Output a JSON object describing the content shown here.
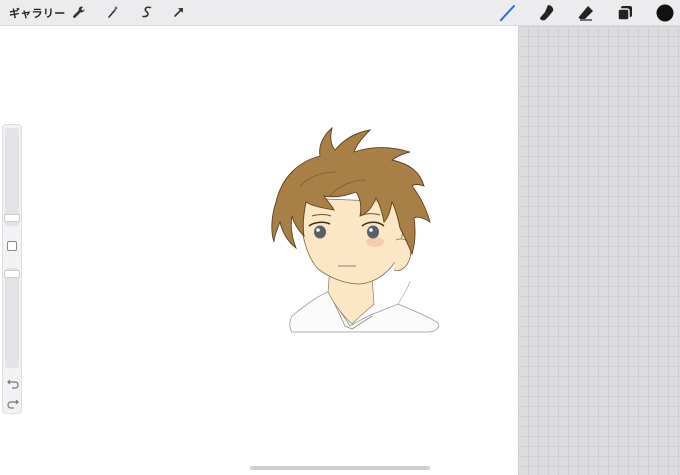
{
  "toolbar": {
    "gallery_label": "ギャラリー",
    "left_tools": [
      "wrench-icon",
      "magic-wand-icon",
      "selection-icon",
      "transform-arrow-icon"
    ],
    "right_tools": [
      "brush-icon",
      "smudge-icon",
      "eraser-icon",
      "layers-icon",
      "color-swatch"
    ],
    "active_tool": "brush",
    "active_color": "#111111",
    "accent_color": "#1f6fe0"
  },
  "sidebar": {
    "brush_size_level": 0.1,
    "opacity_level": 0.95
  },
  "canvas": {
    "artwork": "anime-boy-portrait",
    "background": "#ffffff"
  }
}
